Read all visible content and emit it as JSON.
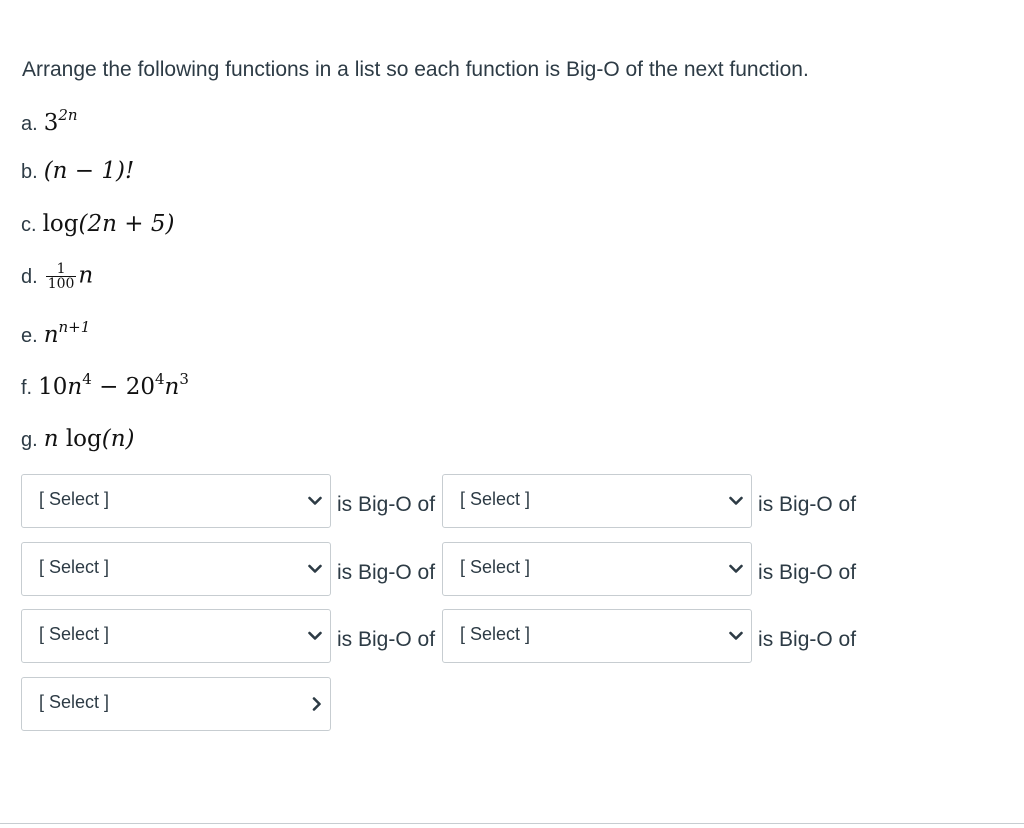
{
  "question": {
    "prompt": "Arrange the following functions in a list so each function is Big-O of the next function."
  },
  "functions": [
    {
      "label": "a.",
      "expr": "3^(2n)"
    },
    {
      "label": "b.",
      "expr": "(n − 1)!"
    },
    {
      "label": "c.",
      "expr": "log(2n + 5)"
    },
    {
      "label": "d.",
      "expr": "(1/100)n"
    },
    {
      "label": "e.",
      "expr": "n^(n+1)"
    },
    {
      "label": "f.",
      "expr": "10n^4 − 20^4n^3"
    },
    {
      "label": "g.",
      "expr": "n log(n)"
    }
  ],
  "math_text": {
    "a_base": "3",
    "a_exp": "2n",
    "b_expr": "(n − 1)!",
    "c_log": "log",
    "c_arg": "(2n + 5)",
    "d_num": "1",
    "d_den": "100",
    "d_var": "n",
    "e_base": "n",
    "e_exp": "n+1",
    "f_coef1": "10",
    "f_var1": "n",
    "f_exp1": "4",
    "f_minus": "−",
    "f_coef2": "20",
    "f_exp2": "4",
    "f_var2": "n",
    "f_exp3": "3",
    "g_var": "n",
    "g_log": "log",
    "g_arg": "(n)"
  },
  "dropdowns": {
    "placeholder": "[ Select ]",
    "connector": "is Big-O of"
  },
  "colors": {
    "text": "#2d3b45",
    "border": "#c7cdd1",
    "background": "#ffffff"
  }
}
